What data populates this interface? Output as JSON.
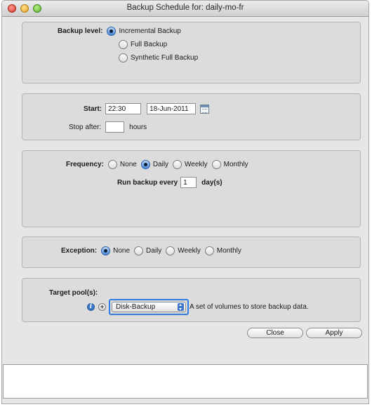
{
  "window": {
    "title": "Backup Schedule for: daily-mo-fr"
  },
  "backup_level": {
    "label": "Backup level:",
    "options": [
      {
        "label": "Incremental Backup",
        "selected": true
      },
      {
        "label": "Full Backup",
        "selected": false
      },
      {
        "label": "Synthetic Full Backup",
        "selected": false
      }
    ]
  },
  "start": {
    "label": "Start:",
    "time_value": "22:30",
    "date_value": "18-Jun-2011",
    "stop_after_label": "Stop after:",
    "stop_after_value": "",
    "hours_label": "hours"
  },
  "frequency": {
    "label": "Frequency:",
    "options": [
      {
        "label": "None",
        "selected": false
      },
      {
        "label": "Daily",
        "selected": true
      },
      {
        "label": "Weekly",
        "selected": false
      },
      {
        "label": "Monthly",
        "selected": false
      }
    ],
    "run_every_label": "Run backup every",
    "run_every_value": "1",
    "run_every_unit": "day(s)"
  },
  "exception": {
    "label": "Exception:",
    "options": [
      {
        "label": "None",
        "selected": true
      },
      {
        "label": "Daily",
        "selected": false
      },
      {
        "label": "Weekly",
        "selected": false
      },
      {
        "label": "Monthly",
        "selected": false
      }
    ]
  },
  "target_pool": {
    "label": "Target pool(s):",
    "selected_value": "Disk-Backup",
    "description": "A set of volumes to store backup data.",
    "icons": [
      "info-icon",
      "plus-icon"
    ]
  },
  "buttons": {
    "close_label": "Close",
    "apply_label": "Apply"
  },
  "colors": {
    "focus_ring": "#2f7de1",
    "radio_selected": "#4a87d8",
    "panel_bg": "#dcdcdc"
  }
}
